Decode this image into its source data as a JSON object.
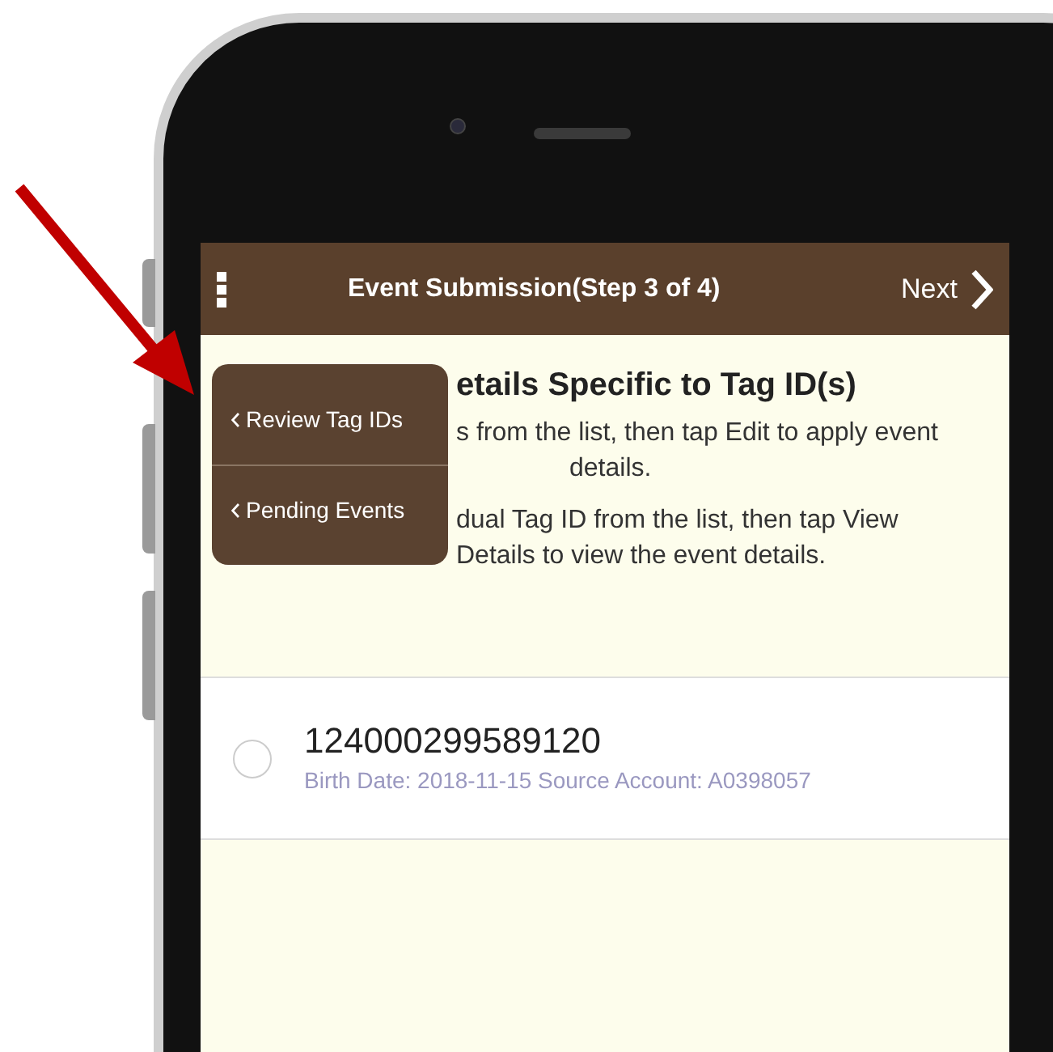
{
  "header": {
    "title": "Event Submission(Step 3 of 4)",
    "next": "Next"
  },
  "menu": {
    "items": [
      {
        "label": "Review Tag IDs"
      },
      {
        "label": "Pending Events"
      }
    ]
  },
  "instructions": {
    "heading": "etails Specific to Tag ID(s)",
    "lines": [
      "s from the list, then tap Edit to apply event",
      "details.",
      "dual Tag ID from the list, then tap View",
      "Details to view the event details."
    ]
  },
  "tags": [
    {
      "tag_id": "124000299589120",
      "details": "Birth Date: 2018-11-15 Source Account: A0398057",
      "selected": false
    }
  ]
}
